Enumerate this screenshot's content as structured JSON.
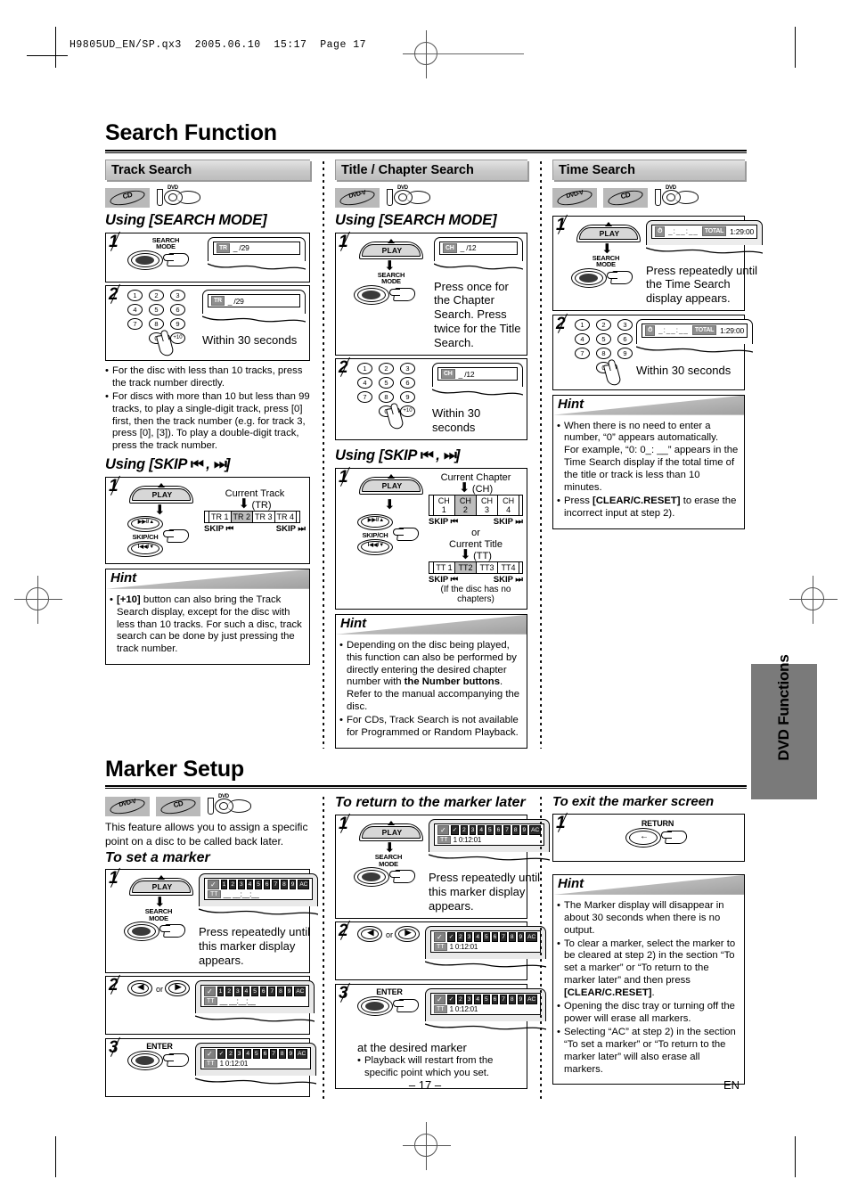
{
  "prepress": {
    "header": "H9805UD_EN/SP.qx3  2005.06.10  15:17  Page 17"
  },
  "sections": [
    {
      "title": "Search Function"
    },
    {
      "title": "Marker Setup"
    }
  ],
  "search": {
    "title": "Search Function",
    "columns": [
      {
        "header": "Track Search",
        "discs": [
          "CD",
          "DVD"
        ],
        "howto1": "Using [SEARCH MODE]",
        "step1_note": "",
        "step2_note": "Within 30 seconds",
        "display1": {
          "seg": "TR",
          "value": "_ /29"
        },
        "display2": {
          "seg": "TR",
          "value": "_ /29"
        },
        "bullets": [
          "For the disc with less than 10 tracks, press the track number directly.",
          "For discs with more than 10 but less than 99 tracks, to play a single-digit track, press [0] first, then the track number (e.g. for track 3, press [0], [3]). To play a double-digit track, press the track number."
        ],
        "howto2": "Using [SKIP",
        "howto2_end": "]",
        "skip": {
          "caption_top": "Current Track",
          "caption_sub": "(TR)",
          "cells": [
            "TR 1",
            "TR 2",
            "TR 3",
            "TR 4"
          ],
          "highlight_index": 1,
          "skip_back": "SKIP",
          "skip_fwd": "SKIP"
        },
        "hint_title": "Hint",
        "hint_bullets": [
          "[+10] button can also bring the Track Search display, except for the disc with less than 10 tracks. For such a disc, track search can be done by just pressing the track number."
        ]
      },
      {
        "header": "Title / Chapter Search",
        "discs": [
          "DVD-V",
          "DVD"
        ],
        "howto1": "Using [SEARCH MODE]",
        "step1_note": "Press once for the Chapter Search. Press twice for the Title Search.",
        "step2_note": "Within 30 seconds",
        "display1": {
          "seg": "CH",
          "value": "_ /12"
        },
        "display2": {
          "seg": "CH",
          "value": "_ /12"
        },
        "howto2": "Using [SKIP",
        "howto2_end": "]",
        "skip": {
          "caption_top": "Current Chapter",
          "caption_sub": "(CH)",
          "cells": [
            "CH 1",
            "CH 2",
            "CH 3",
            "CH 4"
          ],
          "highlight_index": 1,
          "or": "or",
          "caption_top2": "Current Title",
          "caption_sub2": "(TT)",
          "cells2": [
            "TT 1",
            "TT2",
            "TT3",
            "TT4"
          ],
          "highlight_index2": 1,
          "footnote": "(If the disc has no chapters)",
          "skip_back": "SKIP",
          "skip_fwd": "SKIP"
        },
        "hint_title": "Hint",
        "hint_bullets_html": [
          "Depending on the disc being played, this function can also be performed by directly entering the desired chapter number with <b>the Number buttons</b>. Refer to the manual accompanying the disc.",
          "For CDs, Track Search is not available for Programmed or Random Playback."
        ]
      },
      {
        "header": "Time Search",
        "discs": [
          "DVD-V",
          "CD",
          "DVD"
        ],
        "step1_note": "Press repeatedly until the Time Search display appears.",
        "step2_note": "Within 30 seconds",
        "display1": {
          "clock": true,
          "dashes": "_:__:__",
          "total": "TOTAL",
          "time": "1:29:00"
        },
        "display2": {
          "clock": true,
          "dashes": "_:__:__",
          "total": "TOTAL",
          "time": "1:29:00"
        },
        "hint_title": "Hint",
        "hint_bullets_html": [
          "When there is no need to enter a number, “0” appears automatically.<br>For example, “0: 0_: __” appears in the Time Search display if the total time of the title or track is less than 10 minutes.",
          "Press <b>[CLEAR/C.RESET]</b> to erase the incorrect input at step 2)."
        ]
      }
    ]
  },
  "marker": {
    "title": "Marker Setup",
    "discs": [
      "DVD-V",
      "CD",
      "DVD"
    ],
    "intro": "This feature allows you to assign a specific point on a disc to be called back later.",
    "col1": {
      "subtitle": "To set a marker",
      "step1_note": "Press repeatedly until this marker display appears.",
      "display_top": [
        "1",
        "2",
        "3",
        "4",
        "5",
        "6",
        "7",
        "8",
        "9",
        "AC"
      ],
      "display_bottom_seg": "TT",
      "display_bottom_val": "__ __:__:__",
      "display3_top": [
        "✓",
        "2",
        "3",
        "4",
        "5",
        "6",
        "7",
        "8",
        "9",
        "AC"
      ],
      "display3_bottom_val": "1  0:12:01"
    },
    "col2": {
      "subtitle": "To return to the marker later",
      "step1_note": "Press repeatedly until this marker display appears.",
      "display_top": [
        "✓",
        "2",
        "3",
        "4",
        "5",
        "6",
        "7",
        "8",
        "9",
        "AC"
      ],
      "display_bottom_seg": "TT",
      "display_bottom_val": "1  0:12:01",
      "step3_note": "at the desired marker",
      "step3_bullets": [
        "Playback will restart from the specific point which you set."
      ]
    },
    "col3": {
      "subtitle": "To exit the marker screen",
      "return_label": "RETURN",
      "hint_title": "Hint",
      "hint_bullets_html": [
        "The Marker display will disappear in about 30 seconds when there is no output.",
        "To clear a marker, select the marker to be cleared at step 2) in the section “To set a marker” or “To return to the marker later” and then press <b>[CLEAR/C.RESET]</b>.",
        "Opening the disc tray or turning off the power will erase all markers.",
        "Selecting “AC” at step 2) in the section “To set a marker” or “To return to the marker later” will also erase all markers."
      ]
    }
  },
  "sidetab": {
    "label": "DVD Functions"
  },
  "footer": {
    "page": "– 17 –",
    "lang": "EN"
  },
  "keys": {
    "search_mode_line1": "SEARCH",
    "search_mode_line2": "MODE",
    "play": "PLAY",
    "skip_ch": "SKIP/CH",
    "enter": "ENTER",
    "skip_up": "▶▶I/▲",
    "skip_dn": "I◀◀/▼",
    "keypad": [
      "1",
      "2",
      "3",
      "4",
      "5",
      "6",
      "7",
      "8",
      "9",
      "0",
      "+10"
    ],
    "or": "or"
  }
}
